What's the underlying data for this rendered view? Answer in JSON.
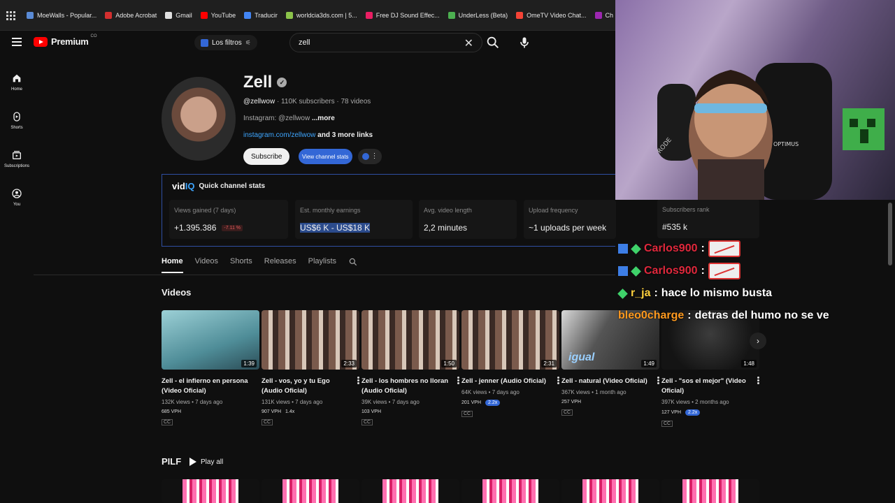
{
  "bookmarks": [
    {
      "label": "MoeWalls - Popular...",
      "color": "#5a8bd6"
    },
    {
      "label": "Adobe Acrobat",
      "color": "#d32f2f"
    },
    {
      "label": "Gmail",
      "color": "#e0e0e0"
    },
    {
      "label": "YouTube",
      "color": "#ff0000"
    },
    {
      "label": "Traducir",
      "color": "#4285f4"
    },
    {
      "label": "worldcia3ds.com | 5...",
      "color": "#8bc34a"
    },
    {
      "label": "Free DJ Sound Effec...",
      "color": "#e91e63"
    },
    {
      "label": "UnderLess (Beta)",
      "color": "#4caf50"
    },
    {
      "label": "OmeTV Video Chat...",
      "color": "#f44336"
    },
    {
      "label": "Ch",
      "color": "#9c27b0"
    }
  ],
  "header": {
    "logo_text": "Premium",
    "country": "CO",
    "filters_label": "Los filtros",
    "search_value": "zell"
  },
  "sidebar": {
    "items": [
      {
        "label": "Home"
      },
      {
        "label": "Shorts"
      },
      {
        "label": "Subscriptions"
      },
      {
        "label": "You"
      }
    ]
  },
  "channel": {
    "name": "Zell",
    "handle": "@zellwow",
    "subs_videos": "· 110K subscribers · 78 videos",
    "description": "Instagram: @zellwow",
    "more": "...more",
    "link": "instagram.com/zellwow",
    "more_links": "and 3 more links",
    "subscribe_label": "Subscribe",
    "stats_label": "View channel stats"
  },
  "stats": {
    "brand_vid": "vid",
    "brand_iq": "IQ",
    "heading": "Quick channel stats",
    "cards": [
      {
        "label": "Views gained (7 days)",
        "value": "+1.395.386",
        "badge": "-7.11 %"
      },
      {
        "label": "Est. monthly earnings",
        "value": "US$6 K - US$18 K",
        "badge": ""
      },
      {
        "label": "Avg. video length",
        "value": "2,2 minutes",
        "badge": ""
      },
      {
        "label": "Upload frequency",
        "value": "~1 uploads per week",
        "badge": ""
      },
      {
        "label": "Subscribers rank",
        "value": "#535 k",
        "badge": ""
      }
    ]
  },
  "tabs": [
    "Home",
    "Videos",
    "Shorts",
    "Releases",
    "Playlists"
  ],
  "videos_section": "Videos",
  "videos": [
    {
      "title": "Zell - el infierno en persona (Video Oficial)",
      "meta": "132K views • 7 days ago",
      "vph": "685 VPH",
      "mult": "",
      "duration": "1:39",
      "bg": "#6fa7b3"
    },
    {
      "title": "Zell - vos, yo y tu Ego (Audio Oficial)",
      "meta": "131K views • 7 days ago",
      "vph": "907 VPH",
      "mult": "1.4x",
      "duration": "2:33",
      "bg": "#5a4a45"
    },
    {
      "title": "Zell - los hombres no lloran (Audio Oficial)",
      "meta": "39K views • 7 days ago",
      "vph": "103 VPH",
      "mult": "",
      "duration": "1:50",
      "bg": "#5a4a45"
    },
    {
      "title": "Zell - jenner (Audio Oficial)",
      "meta": "64K views • 7 days ago",
      "vph": "201 VPH",
      "mult": "2.2x",
      "duration": "2:31",
      "bg": "#5a4a45"
    },
    {
      "title": "Zell - natural (Video Oficial)",
      "meta": "367K views • 1 month ago",
      "vph": "257 VPH",
      "mult": "",
      "duration": "1:49",
      "bg": "#3a3a3a"
    },
    {
      "title": "Zell - \"sos el mejor\" (Video Oficial)",
      "meta": "397K views • 2 months ago",
      "vph": "127 VPH",
      "mult": "2.2x",
      "duration": "1:48",
      "bg": "#2a2a2a"
    }
  ],
  "thumb_overlay_text": "igual",
  "cc_label": "CC",
  "playlist": {
    "title": "PILF",
    "play_all": "Play all"
  },
  "chat": [
    {
      "user": "Carlos900",
      "user_color": "#e0283c",
      "msg": "",
      "emote": true
    },
    {
      "user": "Carlos900",
      "user_color": "#e0283c",
      "msg": "",
      "emote": true
    },
    {
      "user": "r_ja",
      "user_color": "#ffd23f",
      "msg": "hace lo mismo busta",
      "emote": false
    },
    {
      "user": "bleo0charge",
      "user_color": "#ff9a1f",
      "msg": "detras del humo no se ve",
      "emote": false
    }
  ],
  "webcam": {
    "mic_brand": "RODE",
    "chair_brand": "OPTIMUS"
  }
}
